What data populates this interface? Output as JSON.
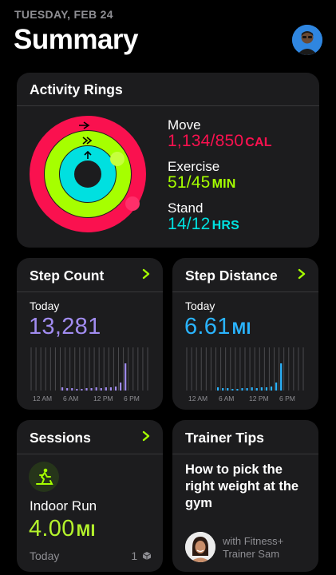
{
  "header": {
    "date": "TUESDAY, FEB 24",
    "title": "Summary"
  },
  "activity": {
    "title": "Activity Rings",
    "move": {
      "label": "Move",
      "value": "1,134/850",
      "unit": "CAL",
      "color": "#fa114f"
    },
    "exercise": {
      "label": "Exercise",
      "value": "51/45",
      "unit": "MIN",
      "color": "#a6ff00"
    },
    "stand": {
      "label": "Stand",
      "value": "14/12",
      "unit": "HRS",
      "color": "#00e0e0"
    }
  },
  "step_count": {
    "title": "Step Count",
    "period": "Today",
    "value": "13,281",
    "color": "#a18cf0",
    "axis": [
      "12 AM",
      "6 AM",
      "12 PM",
      "6 PM"
    ]
  },
  "step_distance": {
    "title": "Step Distance",
    "period": "Today",
    "value": "6.61",
    "unit": "MI",
    "color": "#2ab4ff",
    "axis": [
      "12 AM",
      "6 AM",
      "12 PM",
      "6 PM"
    ]
  },
  "sessions": {
    "title": "Sessions",
    "name": "Indoor Run",
    "value": "4.00",
    "unit": "MI",
    "period": "Today",
    "count": "1"
  },
  "trainer_tips": {
    "title": "Trainer Tips",
    "tip": "How to pick the right weight at the gym",
    "with_line1": "with Fitness+",
    "with_line2": "Trainer Sam"
  }
}
